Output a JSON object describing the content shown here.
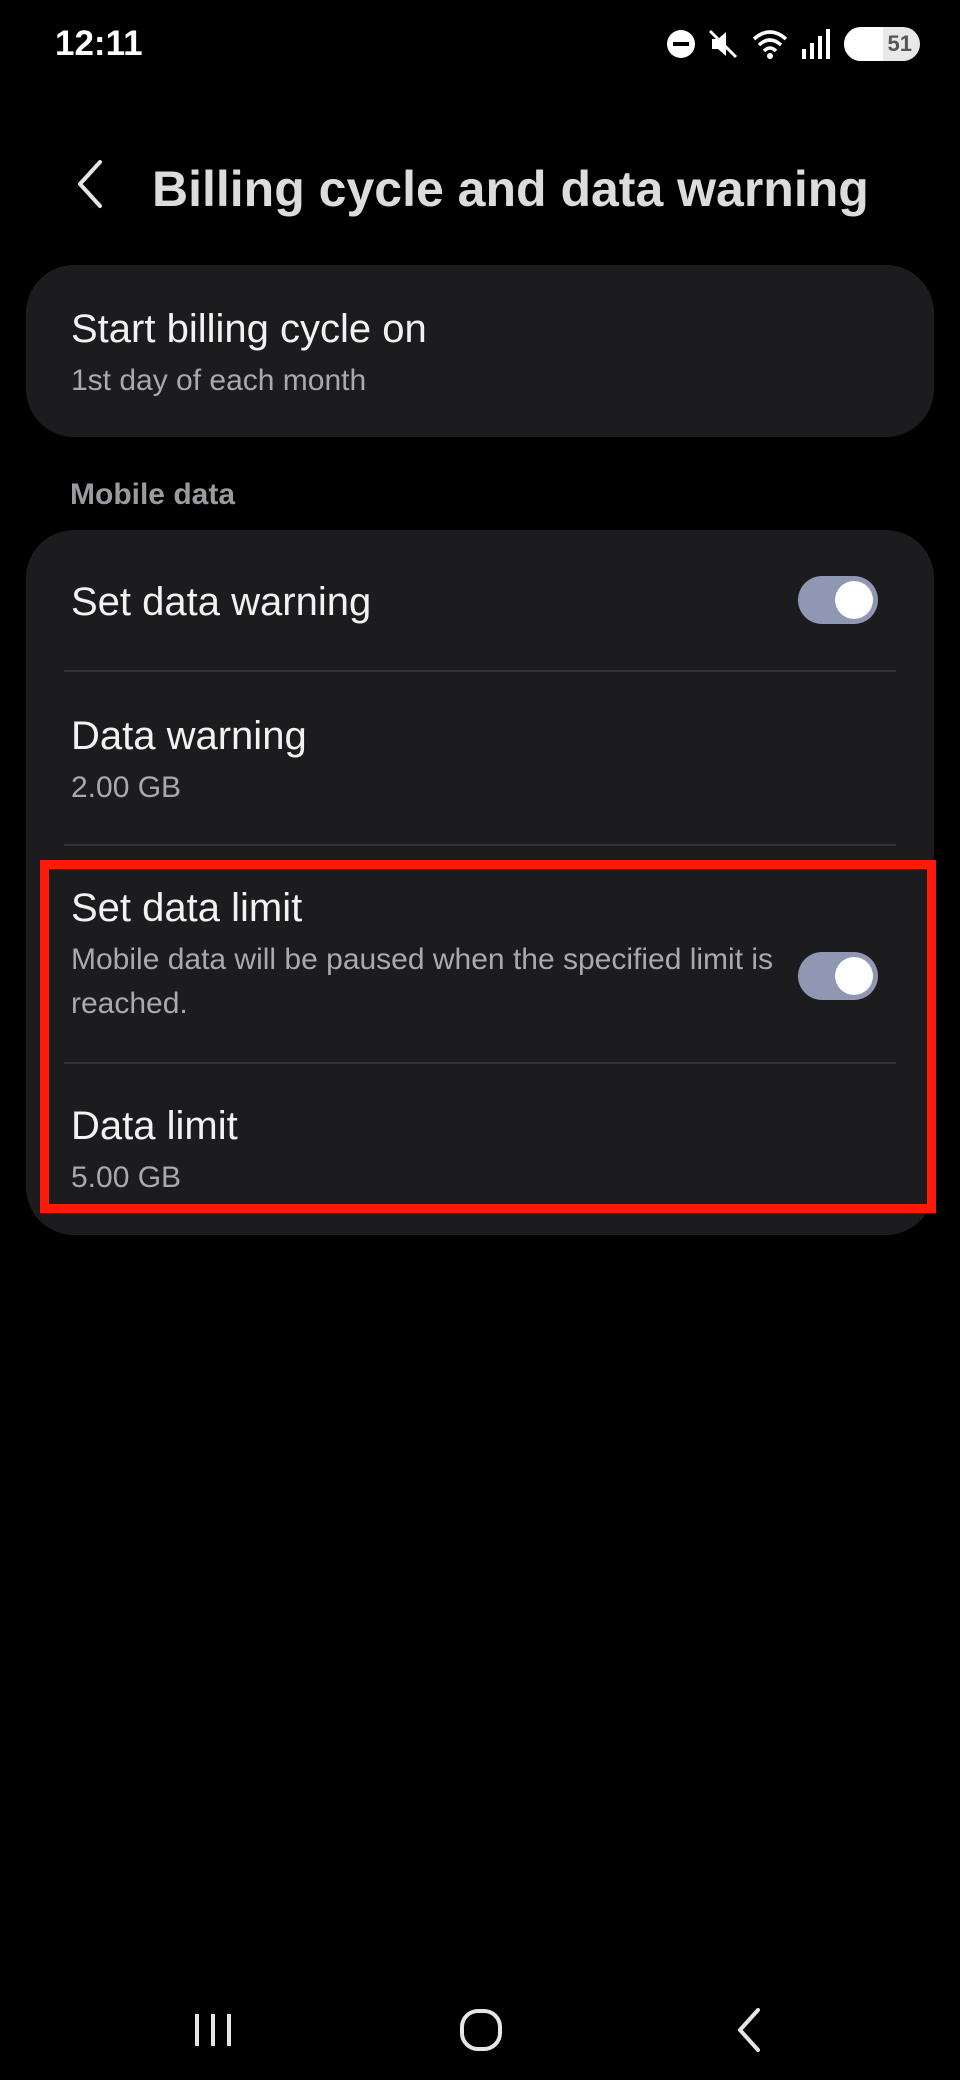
{
  "status_bar": {
    "time": "12:11",
    "battery_level": "51",
    "icons": [
      "do-not-disturb-icon",
      "mute-icon",
      "wifi-icon",
      "signal-icon",
      "battery-icon"
    ]
  },
  "header": {
    "back_icon": "back-arrow-icon",
    "title": "Billing cycle and data warning"
  },
  "billing": {
    "title": "Start billing cycle on",
    "value": "1st day of each month"
  },
  "mobile_data": {
    "section_label": "Mobile data",
    "set_data_warning": {
      "title": "Set data warning",
      "enabled": true
    },
    "data_warning": {
      "title": "Data warning",
      "value": "2.00 GB"
    },
    "set_data_limit": {
      "title": "Set data limit",
      "description": "Mobile data will be paused when the specified limit is reached.",
      "enabled": true
    },
    "data_limit": {
      "title": "Data limit",
      "value": "5.00 GB"
    }
  },
  "colors": {
    "background": "#000000",
    "card": "#1c1c1e",
    "toggle_on": "#8f97b3",
    "highlight": "#ff1a0a"
  },
  "nav_bar": {
    "recents_icon": "recents-icon",
    "home_icon": "home-icon",
    "back_icon": "back-icon"
  }
}
